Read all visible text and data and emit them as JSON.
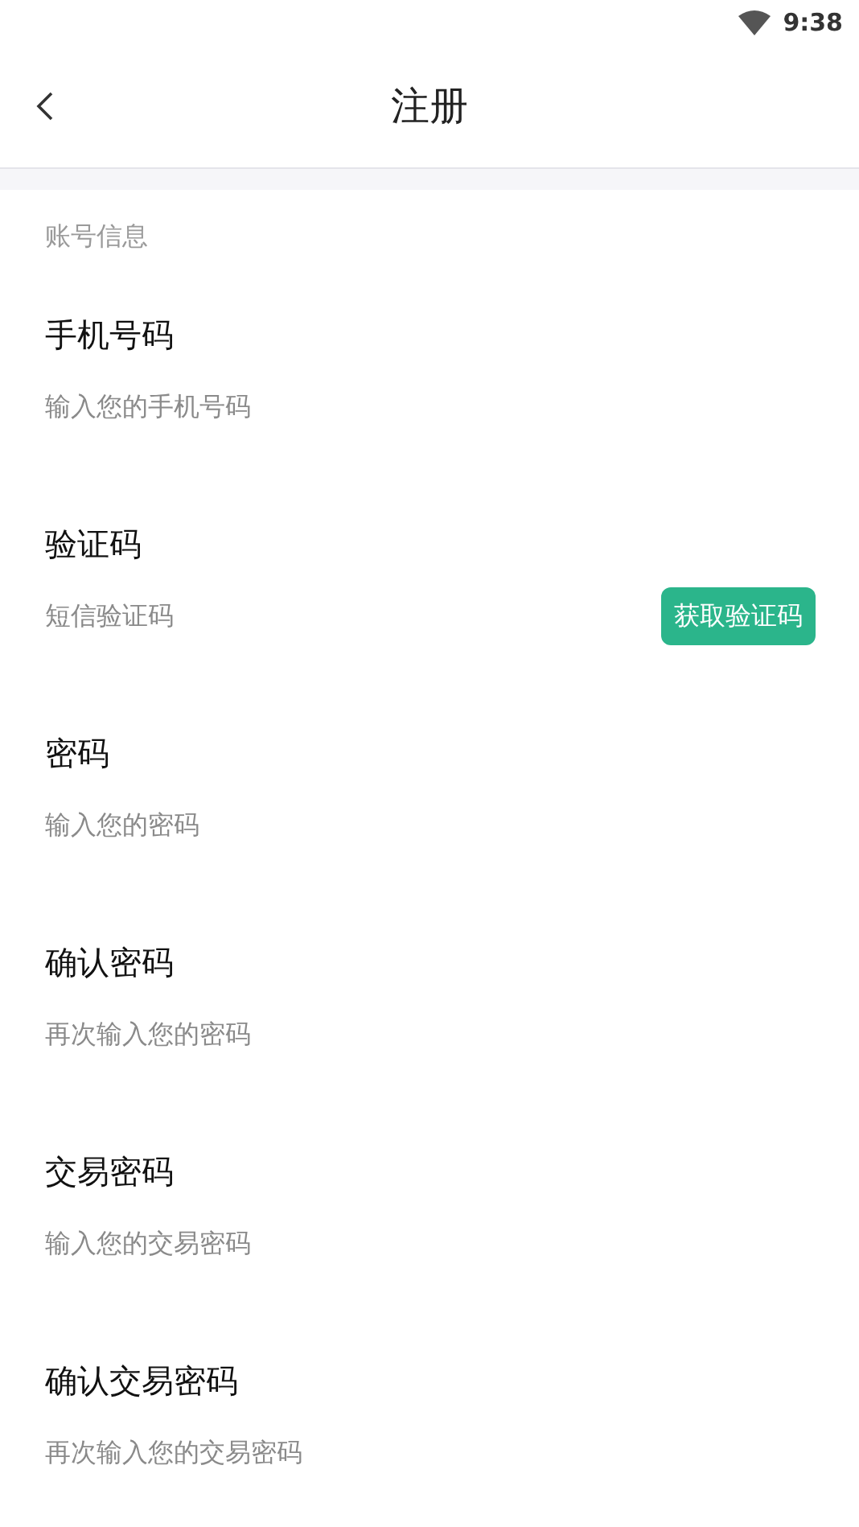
{
  "status_bar": {
    "time": "9:38"
  },
  "header": {
    "title": "注册"
  },
  "section": {
    "label": "账号信息"
  },
  "fields": [
    {
      "label": "手机号码",
      "placeholder": "输入您的手机号码"
    },
    {
      "label": "验证码",
      "placeholder": "短信验证码",
      "button": "获取验证码"
    },
    {
      "label": "密码",
      "placeholder": "输入您的密码"
    },
    {
      "label": "确认密码",
      "placeholder": "再次输入您的密码"
    },
    {
      "label": "交易密码",
      "placeholder": "输入您的交易密码"
    },
    {
      "label": "确认交易密码",
      "placeholder": "再次输入您的交易密码"
    }
  ]
}
